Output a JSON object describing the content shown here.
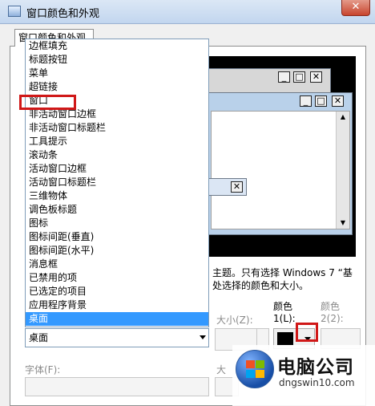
{
  "window": {
    "title": "窗口颜色和外观",
    "close_glyph": "✕"
  },
  "tab": {
    "label": "窗口颜色和外观"
  },
  "item_list": {
    "items": [
      "边框填充",
      "标题按钮",
      "菜单",
      "超链接",
      "窗口",
      "非活动窗口边框",
      "非活动窗口标题栏",
      "工具提示",
      "滚动条",
      "活动窗口边框",
      "活动窗口标题栏",
      "三维物体",
      "调色板标题",
      "图标",
      "图标间距(垂直)",
      "图标间距(水平)",
      "消息框",
      "已禁用的项",
      "已选定的项目",
      "应用程序背景",
      "桌面"
    ],
    "selected": "桌面",
    "highlighted": "窗口"
  },
  "item_combo": {
    "value": "桌面"
  },
  "description": {
    "line1": "主题。只有选择 Windows 7 “基",
    "line2": "处选择的颜色和大小。"
  },
  "size": {
    "label": "大小(Z):"
  },
  "color1": {
    "label_top": "颜色",
    "label_bottom": "1(L):",
    "swatch_color": "#000000"
  },
  "color2": {
    "label_top": "颜色",
    "label_bottom": "2(2):"
  },
  "font": {
    "label": "字体(F):"
  },
  "font_size": {
    "label": "大"
  },
  "preview": {
    "min_glyph": "_",
    "max_glyph": "□",
    "close_glyph": "✕",
    "scroll_up": "▲",
    "scroll_down": "▼"
  },
  "watermark": {
    "title": "电脑公司",
    "url": "dngswin10.com"
  },
  "colors": {
    "highlight": "#d01818",
    "selection": "#3399ff"
  }
}
